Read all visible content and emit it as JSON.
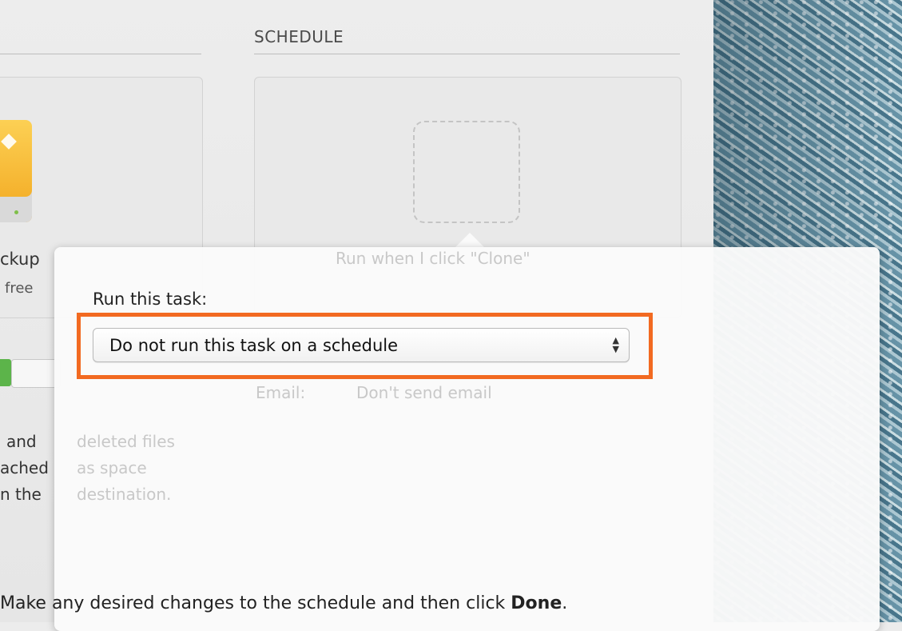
{
  "header": {
    "schedule_title": "SCHEDULE"
  },
  "source_pane": {
    "name_fragment": "ckup",
    "free_fragment": "free"
  },
  "description_fragments": [
    "and",
    "ached",
    "n the"
  ],
  "faded_text": {
    "run_when": "Run when I click \"Clone\"",
    "email_label": "Email:",
    "email_value": "Don't send email",
    "desc_1": "deleted files",
    "desc_2": "as space",
    "desc_3": "destination."
  },
  "popover": {
    "run_label": "Run this task:",
    "select_value": "Do not run this task on a schedule"
  },
  "caption": {
    "text_before": "Make any desired changes to the schedule and then click ",
    "bold": "Done",
    "text_after": "."
  },
  "colors": {
    "highlight": "#f26a21",
    "toggle_on": "#5cb44a"
  }
}
